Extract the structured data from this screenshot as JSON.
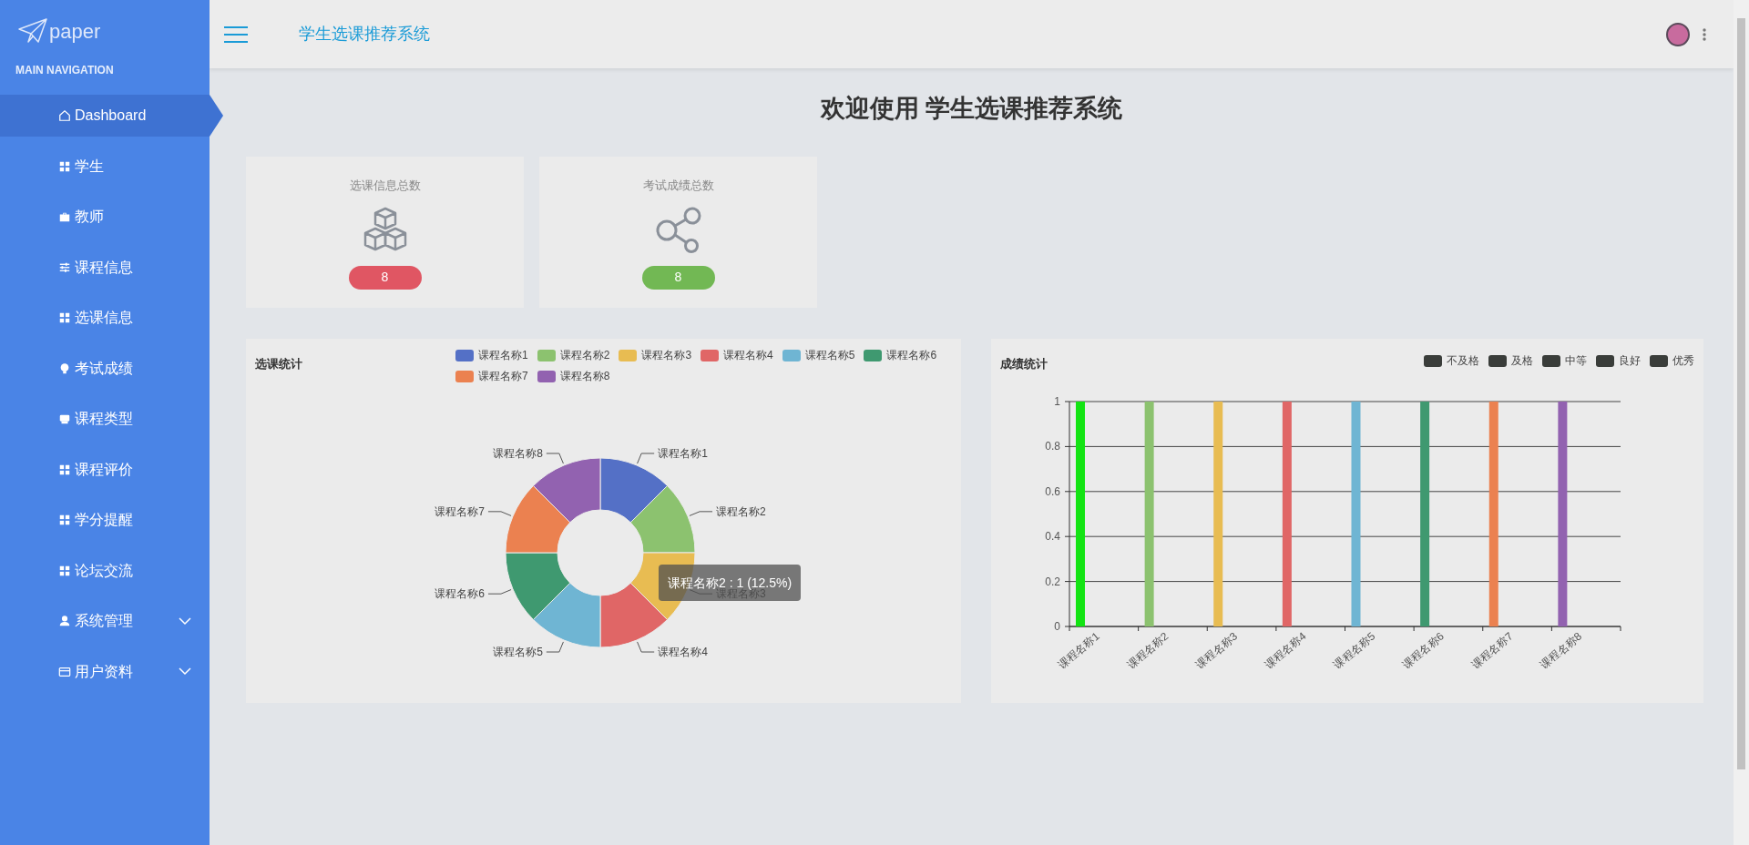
{
  "sidebar": {
    "logo": "paper",
    "section": "MAIN NAVIGATION",
    "items": [
      {
        "label": "Dashboard",
        "kind": "home",
        "selected": true,
        "expandable": false
      },
      {
        "label": "学生",
        "kind": "grid",
        "selected": false,
        "expandable": false
      },
      {
        "label": "教师",
        "kind": "briefcase",
        "selected": false,
        "expandable": false
      },
      {
        "label": "课程信息",
        "kind": "sliders",
        "selected": false,
        "expandable": false
      },
      {
        "label": "选课信息",
        "kind": "grid",
        "selected": false,
        "expandable": false
      },
      {
        "label": "考试成绩",
        "kind": "bulb",
        "selected": false,
        "expandable": false
      },
      {
        "label": "课程类型",
        "kind": "printer",
        "selected": false,
        "expandable": false
      },
      {
        "label": "课程评价",
        "kind": "grid",
        "selected": false,
        "expandable": false
      },
      {
        "label": "学分提醒",
        "kind": "grid",
        "selected": false,
        "expandable": false
      },
      {
        "label": "论坛交流",
        "kind": "grid",
        "selected": false,
        "expandable": false
      },
      {
        "label": "系统管理",
        "kind": "user",
        "selected": false,
        "expandable": true
      },
      {
        "label": "用户资料",
        "kind": "card",
        "selected": false,
        "expandable": true
      }
    ]
  },
  "topbar": {
    "title": "学生选课推荐系统"
  },
  "heading": "欢迎使用 学生选课推荐系统",
  "stats": [
    {
      "label": "选课信息总数",
      "kind": "cubes",
      "value": "8",
      "color": "#e05663"
    },
    {
      "label": "考试成绩总数",
      "kind": "share",
      "value": "8",
      "color": "#72b854"
    }
  ],
  "pie_panel": {
    "title": "选课统计",
    "legend": [
      {
        "label": "课程名称1",
        "color": "#5470c6"
      },
      {
        "label": "课程名称2",
        "color": "#8cc26f"
      },
      {
        "label": "课程名称3",
        "color": "#e8bc52"
      },
      {
        "label": "课程名称4",
        "color": "#e06666"
      },
      {
        "label": "课程名称5",
        "color": "#6fb5d3"
      },
      {
        "label": "课程名称6",
        "color": "#3f9970"
      },
      {
        "label": "课程名称7",
        "color": "#eb8150"
      },
      {
        "label": "课程名称8",
        "color": "#9262b0"
      }
    ],
    "chart_data": {
      "type": "donut",
      "categories": [
        "课程名称1",
        "课程名称2",
        "课程名称3",
        "课程名称4",
        "课程名称5",
        "课程名称6",
        "课程名称7",
        "课程名称8"
      ],
      "values": [
        1,
        1,
        1,
        1,
        1,
        1,
        1,
        1
      ]
    },
    "tooltip": "课程名称2 : 1 (12.5%)"
  },
  "bar_panel": {
    "title": "成绩统计",
    "legend": [
      "不及格",
      "及格",
      "中等",
      "良好",
      "优秀"
    ],
    "bars": [
      {
        "color": "#13e413"
      },
      {
        "color": "#8cc26f"
      },
      {
        "color": "#e8bc52"
      },
      {
        "color": "#e06666"
      },
      {
        "color": "#6fb5d3"
      },
      {
        "color": "#3f9970"
      },
      {
        "color": "#eb8150"
      },
      {
        "color": "#9262b0"
      }
    ],
    "chart_data": {
      "type": "bar",
      "categories": [
        "课程名称1",
        "课程名称2",
        "课程名称3",
        "课程名称4",
        "课程名称5",
        "课程名称6",
        "课程名称7",
        "课程名称8"
      ],
      "values": [
        1,
        1,
        1,
        1,
        1,
        1,
        1,
        1
      ],
      "ylim": [
        0,
        1
      ],
      "yticks": [
        0,
        0.2,
        0.4,
        0.6,
        0.8,
        1
      ],
      "grid": true
    }
  }
}
